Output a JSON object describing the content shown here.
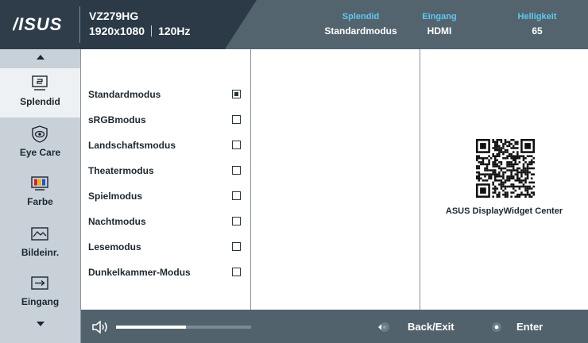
{
  "header": {
    "brand": "ASUS",
    "model": "VZ279HG",
    "resolution": "1920x1080",
    "refresh": "120Hz",
    "status": [
      {
        "label": "Splendid",
        "value": "Standardmodus"
      },
      {
        "label": "Eingang",
        "value": "HDMI"
      },
      {
        "label": "Helligkeit",
        "value": "65"
      }
    ]
  },
  "nav": {
    "items": [
      {
        "label": "Splendid",
        "icon": "splendid-monitor-icon",
        "active": true
      },
      {
        "label": "Eye Care",
        "icon": "eye-care-icon",
        "active": false
      },
      {
        "label": "Farbe",
        "icon": "color-bars-icon",
        "active": false
      },
      {
        "label": "Bildeinr.",
        "icon": "image-wave-icon",
        "active": false
      },
      {
        "label": "Eingang",
        "icon": "input-arrow-icon",
        "active": false
      }
    ]
  },
  "modes": [
    {
      "label": "Standardmodus",
      "checked": true
    },
    {
      "label": "sRGBmodus",
      "checked": false
    },
    {
      "label": "Landschaftsmodus",
      "checked": false
    },
    {
      "label": "Theatermodus",
      "checked": false
    },
    {
      "label": "Spielmodus",
      "checked": false
    },
    {
      "label": "Nachtmodus",
      "checked": false
    },
    {
      "label": "Lesemodus",
      "checked": false
    },
    {
      "label": "Dunkelkammer-Modus",
      "checked": false
    }
  ],
  "widget": {
    "caption": "ASUS DisplayWidget Center"
  },
  "footer": {
    "volume_level": 0.52,
    "back_label": "Back/Exit",
    "enter_label": "Enter"
  },
  "colors": {
    "header_dark": "#2b3a46",
    "header_light": "#53646f",
    "accent_label": "#5ec8ee",
    "nav_bg": "#c8d1d7",
    "footer_bg": "#52626d"
  }
}
